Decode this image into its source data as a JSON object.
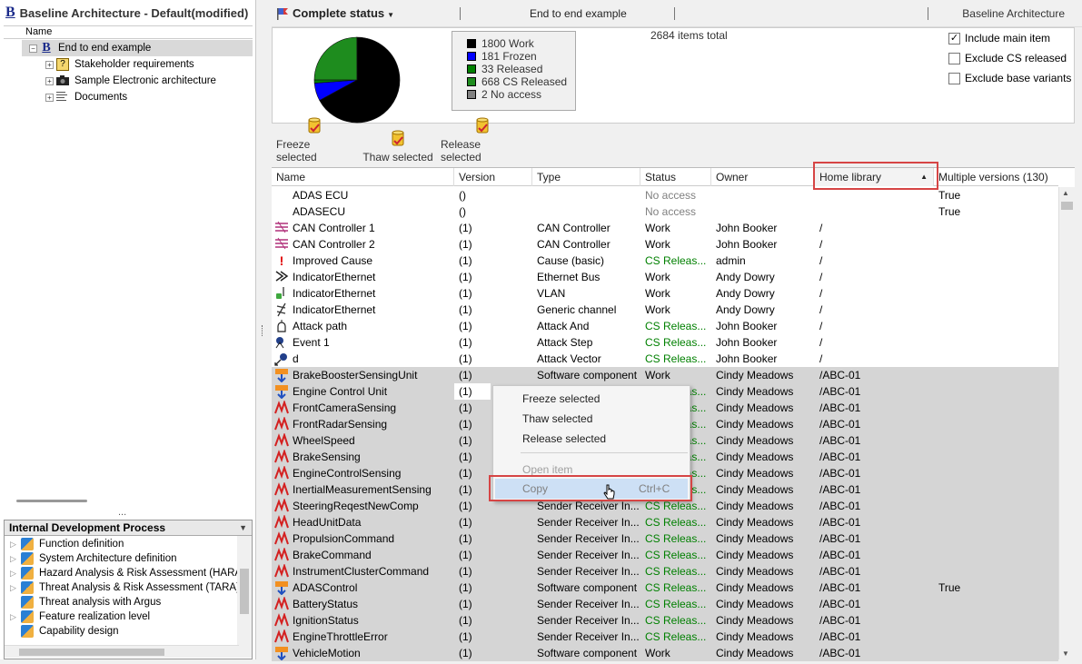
{
  "left_panel": {
    "title": "Baseline Architecture - Default(modified)",
    "column_header": "Name",
    "tree": [
      {
        "label": "End to end example",
        "icon": "baseline-b-icon",
        "expanded": true
      },
      {
        "label": "Stakeholder requirements",
        "icon": "requirements-icon"
      },
      {
        "label": "Sample Electronic architecture",
        "icon": "camera-icon"
      },
      {
        "label": "Documents",
        "icon": "documents-icon"
      }
    ],
    "dots": "...",
    "process_title": "Internal Development Process",
    "process_items": [
      "Function definition",
      "System Architecture definition",
      "Hazard Analysis & Risk Assessment (HARA",
      "Threat Analysis & Risk Assessment (TARA)",
      "Threat analysis with Argus",
      "Feature realization level",
      "Capability design"
    ]
  },
  "header": {
    "status_menu": "Complete status",
    "center_title": "End to end example",
    "right_title": "Baseline Architecture"
  },
  "summary": {
    "total": "2684 items total",
    "legend": [
      {
        "label": "1800 Work",
        "color": "#000000"
      },
      {
        "label": "181 Frozen",
        "color": "#0000ff"
      },
      {
        "label": "33 Released",
        "color": "#008000"
      },
      {
        "label": "668 CS Released",
        "color": "#1e8c1e"
      },
      {
        "label": "2 No access",
        "color": "#808080"
      }
    ],
    "pie_values": [
      1800,
      181,
      33,
      668,
      2
    ],
    "options": [
      {
        "label": "Include main item",
        "checked": true
      },
      {
        "label": "Exclude CS released",
        "checked": false
      },
      {
        "label": "Exclude base variants",
        "checked": false
      }
    ]
  },
  "toolbar": {
    "freeze": "Freeze selected",
    "thaw": "Thaw selected",
    "release": "Release selected"
  },
  "columns": {
    "name": "Name",
    "version": "Version",
    "type": "Type",
    "status": "Status",
    "owner": "Owner",
    "home": "Home library",
    "multi": "Multiple versions (130)"
  },
  "rows": [
    {
      "icon": "",
      "name": "ADAS ECU",
      "version": "()",
      "type": "",
      "status": "No access",
      "st": "gray",
      "owner": "",
      "home": "",
      "multi": "True",
      "sel": false
    },
    {
      "icon": "",
      "name": "ADASECU",
      "version": "()",
      "type": "",
      "status": "No access",
      "st": "gray",
      "owner": "",
      "home": "",
      "multi": "True",
      "sel": false
    },
    {
      "icon": "can-controller-icon",
      "name": "CAN Controller 1",
      "version": "(1)",
      "type": "CAN Controller",
      "status": "Work",
      "st": "",
      "owner": "John Booker",
      "home": "/",
      "multi": "",
      "sel": false
    },
    {
      "icon": "can-controller-icon",
      "name": "CAN Controller 2",
      "version": "(1)",
      "type": "CAN Controller",
      "status": "Work",
      "st": "",
      "owner": "John Booker",
      "home": "/",
      "multi": "",
      "sel": false
    },
    {
      "icon": "exclamation-icon",
      "name": "Improved Cause",
      "version": "(1)",
      "type": "Cause (basic)",
      "status": "CS Releas...",
      "st": "green",
      "owner": "admin",
      "home": "/",
      "multi": "",
      "sel": false
    },
    {
      "icon": "ethernet-bus-icon",
      "name": "IndicatorEthernet",
      "version": "(1)",
      "type": "Ethernet Bus",
      "status": "Work",
      "st": "",
      "owner": "Andy Dowry",
      "home": "/",
      "multi": "",
      "sel": false
    },
    {
      "icon": "vlan-icon",
      "name": "IndicatorEthernet",
      "version": "(1)",
      "type": "VLAN",
      "status": "Work",
      "st": "",
      "owner": "Andy Dowry",
      "home": "/",
      "multi": "",
      "sel": false
    },
    {
      "icon": "generic-channel-icon",
      "name": "IndicatorEthernet",
      "version": "(1)",
      "type": "Generic channel",
      "status": "Work",
      "st": "",
      "owner": "Andy Dowry",
      "home": "/",
      "multi": "",
      "sel": false
    },
    {
      "icon": "attack-path-icon",
      "name": "Attack path",
      "version": "(1)",
      "type": "Attack And",
      "status": "CS Releas...",
      "st": "green",
      "owner": "John Booker",
      "home": "/",
      "multi": "",
      "sel": false
    },
    {
      "icon": "attack-step-icon",
      "name": "Event 1",
      "version": "(1)",
      "type": "Attack Step",
      "status": "CS Releas...",
      "st": "green",
      "owner": "John Booker",
      "home": "/",
      "multi": "",
      "sel": false
    },
    {
      "icon": "attack-vector-icon",
      "name": "d",
      "version": "(1)",
      "type": "Attack Vector",
      "status": "CS Releas...",
      "st": "green",
      "owner": "John Booker",
      "home": "/",
      "multi": "",
      "sel": false
    },
    {
      "icon": "software-component-icon",
      "name": "BrakeBoosterSensingUnit",
      "version": "(1)",
      "type": "Software component",
      "status": "Work",
      "st": "",
      "owner": "Cindy Meadows",
      "home": "/ABC-01",
      "multi": "",
      "sel": true
    },
    {
      "icon": "software-component-icon",
      "name": "Engine Control Unit",
      "version": "(1)",
      "type": "",
      "status": "CS Releas...",
      "st": "green",
      "owner": "Cindy Meadows",
      "home": "/ABC-01",
      "multi": "",
      "sel": true
    },
    {
      "icon": "sender-receiver-icon",
      "name": "FrontCameraSensing",
      "version": "(1)",
      "type": "",
      "status": "CS Releas...",
      "st": "green",
      "owner": "Cindy Meadows",
      "home": "/ABC-01",
      "multi": "",
      "sel": true
    },
    {
      "icon": "sender-receiver-icon",
      "name": "FrontRadarSensing",
      "version": "(1)",
      "type": "",
      "status": "CS Releas...",
      "st": "green",
      "owner": "Cindy Meadows",
      "home": "/ABC-01",
      "multi": "",
      "sel": true
    },
    {
      "icon": "sender-receiver-icon",
      "name": "WheelSpeed",
      "version": "(1)",
      "type": "",
      "status": "CS Releas...",
      "st": "green",
      "owner": "Cindy Meadows",
      "home": "/ABC-01",
      "multi": "",
      "sel": true
    },
    {
      "icon": "sender-receiver-icon",
      "name": "BrakeSensing",
      "version": "(1)",
      "type": "",
      "status": "CS Releas...",
      "st": "green",
      "owner": "Cindy Meadows",
      "home": "/ABC-01",
      "multi": "",
      "sel": true
    },
    {
      "icon": "sender-receiver-icon",
      "name": "EngineControlSensing",
      "version": "(1)",
      "type": "",
      "status": "CS Releas...",
      "st": "green",
      "owner": "Cindy Meadows",
      "home": "/ABC-01",
      "multi": "",
      "sel": true
    },
    {
      "icon": "sender-receiver-icon",
      "name": "InertialMeasurementSensing",
      "version": "(1)",
      "type": "",
      "status": "CS Releas...",
      "st": "green",
      "owner": "Cindy Meadows",
      "home": "/ABC-01",
      "multi": "",
      "sel": true
    },
    {
      "icon": "sender-receiver-icon",
      "name": "SteeringReqestNewComp",
      "version": "(1)",
      "type": "Sender Receiver In...",
      "status": "CS Releas...",
      "st": "green",
      "owner": "Cindy Meadows",
      "home": "/ABC-01",
      "multi": "",
      "sel": true
    },
    {
      "icon": "sender-receiver-icon",
      "name": "HeadUnitData",
      "version": "(1)",
      "type": "Sender Receiver In...",
      "status": "CS Releas...",
      "st": "green",
      "owner": "Cindy Meadows",
      "home": "/ABC-01",
      "multi": "",
      "sel": true
    },
    {
      "icon": "sender-receiver-icon",
      "name": "PropulsionCommand",
      "version": "(1)",
      "type": "Sender Receiver In...",
      "status": "CS Releas...",
      "st": "green",
      "owner": "Cindy Meadows",
      "home": "/ABC-01",
      "multi": "",
      "sel": true
    },
    {
      "icon": "sender-receiver-icon",
      "name": "BrakeCommand",
      "version": "(1)",
      "type": "Sender Receiver In...",
      "status": "CS Releas...",
      "st": "green",
      "owner": "Cindy Meadows",
      "home": "/ABC-01",
      "multi": "",
      "sel": true
    },
    {
      "icon": "sender-receiver-icon",
      "name": "InstrumentClusterCommand",
      "version": "(1)",
      "type": "Sender Receiver In...",
      "status": "CS Releas...",
      "st": "green",
      "owner": "Cindy Meadows",
      "home": "/ABC-01",
      "multi": "",
      "sel": true
    },
    {
      "icon": "software-component-icon",
      "name": "ADASControl",
      "version": "(1)",
      "type": "Software component",
      "status": "CS Releas...",
      "st": "green",
      "owner": "Cindy Meadows",
      "home": "/ABC-01",
      "multi": "True",
      "sel": true
    },
    {
      "icon": "sender-receiver-icon",
      "name": "BatteryStatus",
      "version": "(1)",
      "type": "Sender Receiver In...",
      "status": "CS Releas...",
      "st": "green",
      "owner": "Cindy Meadows",
      "home": "/ABC-01",
      "multi": "",
      "sel": true
    },
    {
      "icon": "sender-receiver-icon",
      "name": "IgnitionStatus",
      "version": "(1)",
      "type": "Sender Receiver In...",
      "status": "CS Releas...",
      "st": "green",
      "owner": "Cindy Meadows",
      "home": "/ABC-01",
      "multi": "",
      "sel": true
    },
    {
      "icon": "sender-receiver-icon",
      "name": "EngineThrottleError",
      "version": "(1)",
      "type": "Sender Receiver In...",
      "status": "CS Releas...",
      "st": "green",
      "owner": "Cindy Meadows",
      "home": "/ABC-01",
      "multi": "",
      "sel": true
    },
    {
      "icon": "software-component-icon",
      "name": "VehicleMotion",
      "version": "(1)",
      "type": "Software component",
      "status": "Work",
      "st": "",
      "owner": "Cindy Meadows",
      "home": "/ABC-01",
      "multi": "",
      "sel": true
    }
  ],
  "context_menu": {
    "freeze": "Freeze selected",
    "thaw": "Thaw selected",
    "release": "Release selected",
    "open": "Open item",
    "copy": "Copy",
    "copy_shortcut": "Ctrl+C"
  }
}
